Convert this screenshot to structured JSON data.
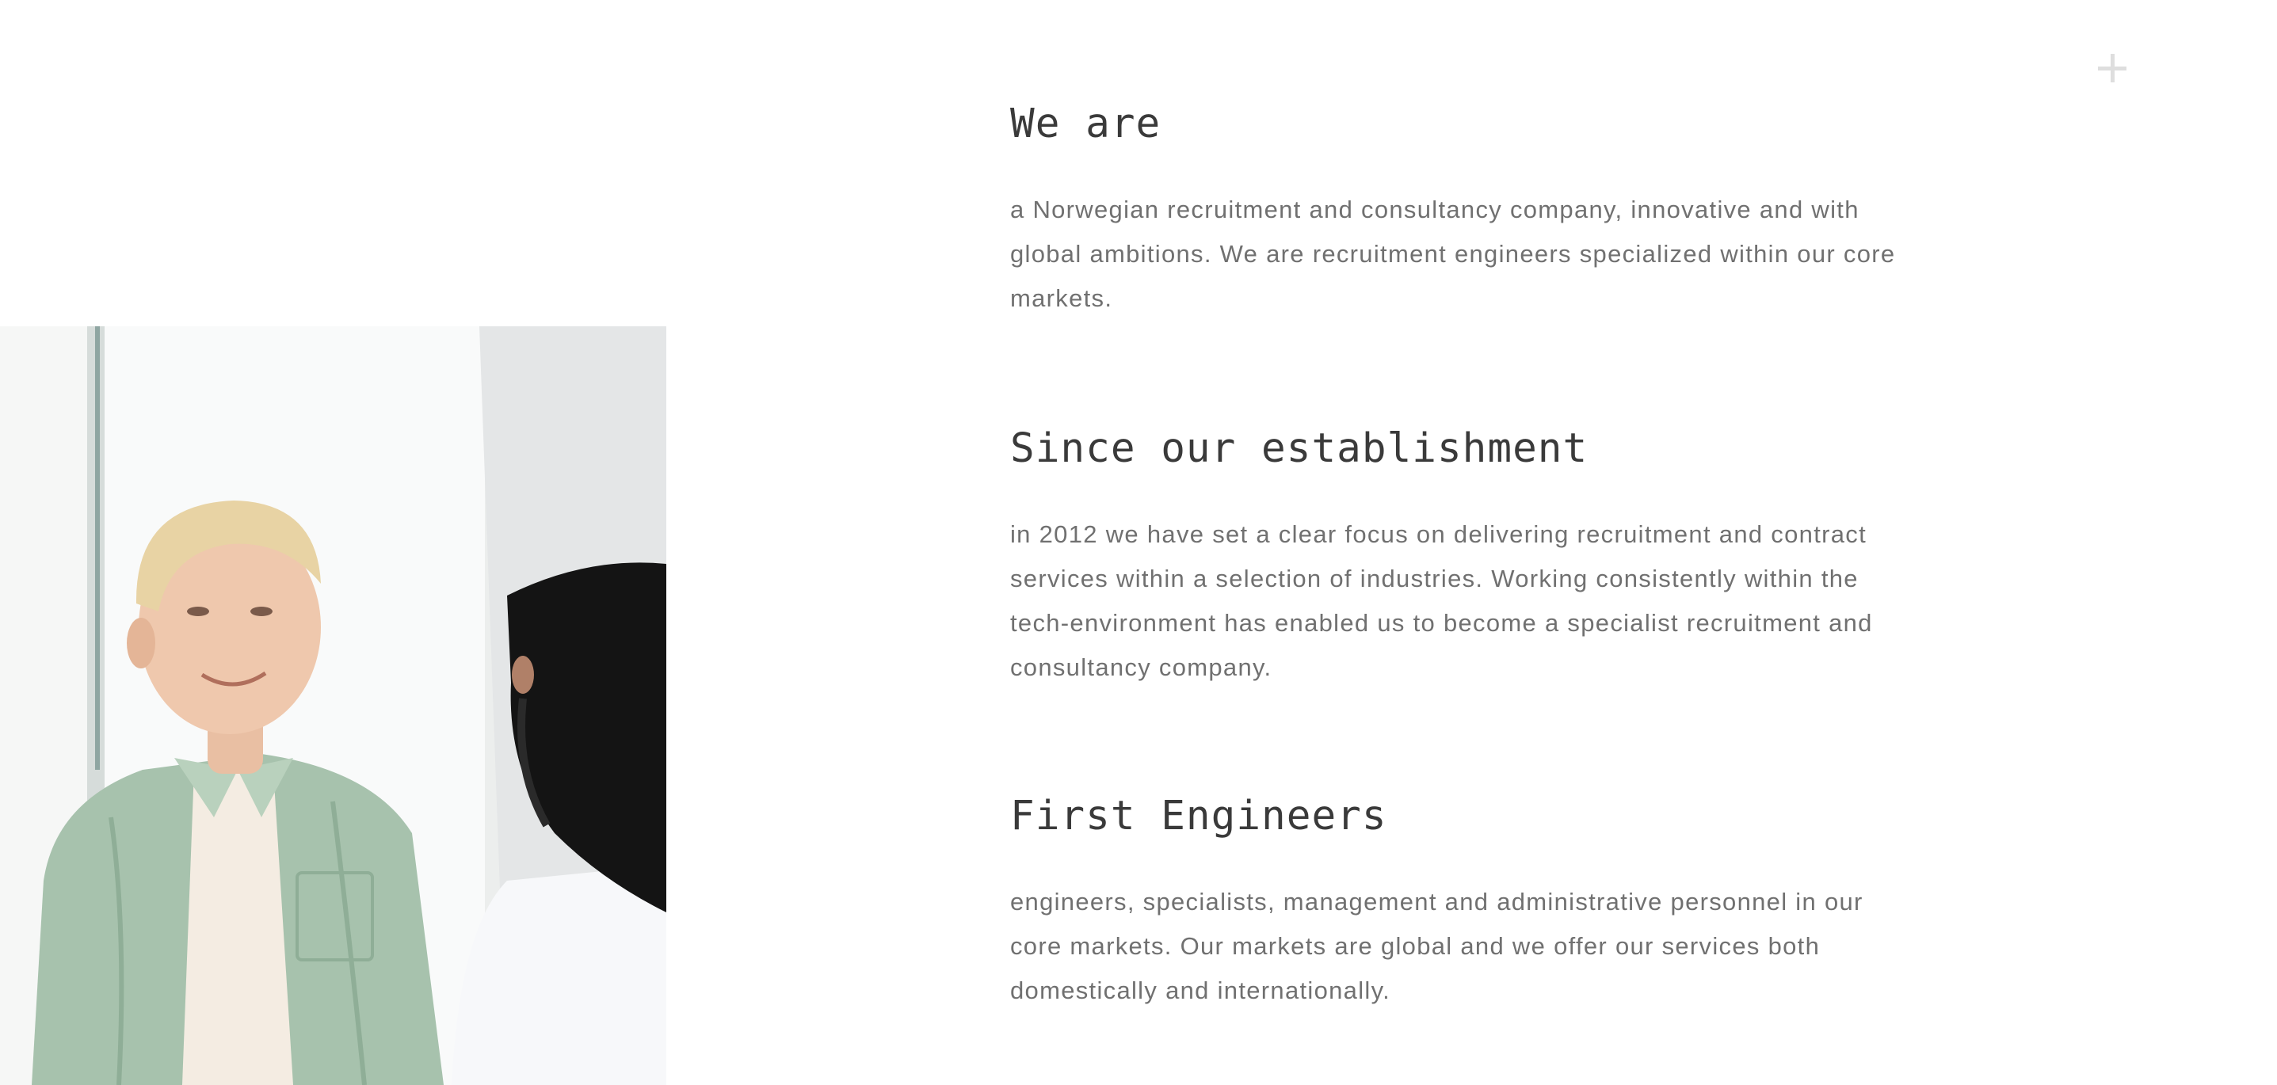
{
  "photo": {
    "subject": "two-people-in-conversation-photo"
  },
  "sections": [
    {
      "title": "We are",
      "body": "a Norwegian recruitment and consultancy company, innovative and with global ambitions. We are recruitment engineers specialized within our core markets."
    },
    {
      "title": "Since our establishment",
      "body": "in 2012 we have set a clear focus on delivering recruitment and contract services within a selection of industries. Working consistently within the tech-environment has enabled us to become a specialist recruitment and consultancy company."
    },
    {
      "title": "First Engineers",
      "body": "engineers, specialists, management and administrative personnel in our core markets. Our markets are global and we offer our services both domestically and internationally."
    }
  ],
  "icons": {
    "expand": "plus-icon"
  },
  "colors": {
    "heading": "#3a3a3a",
    "body": "#707070",
    "plus": "#dedede",
    "background": "#ffffff"
  }
}
